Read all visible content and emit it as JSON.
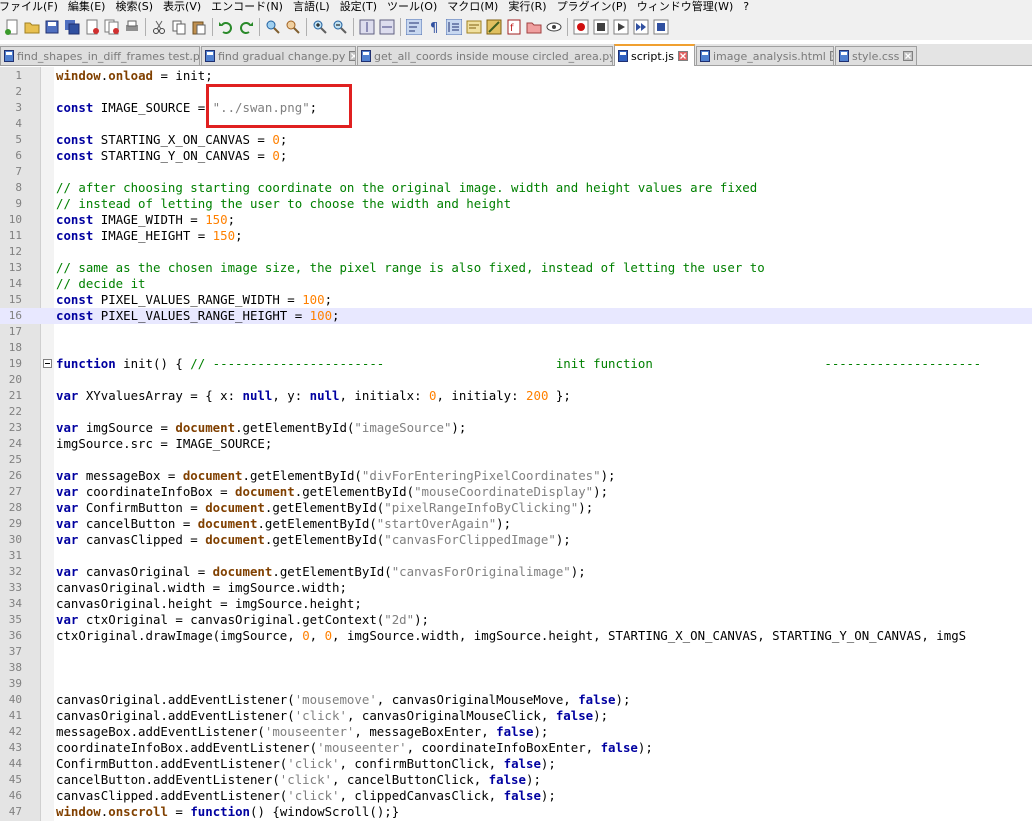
{
  "menu": [
    "ファイル(F)",
    "編集(E)",
    "検索(S)",
    "表示(V)",
    "エンコード(N)",
    "言語(L)",
    "設定(T)",
    "ツール(O)",
    "マクロ(M)",
    "実行(R)",
    "プラグイン(P)",
    "ウィンドウ管理(W)",
    "?"
  ],
  "toolbar": [
    "new-file-icon",
    "open-file-icon",
    "save-icon",
    "save-all-icon",
    "close-icon",
    "close-all-icon",
    "print-icon",
    "sep",
    "cut-icon",
    "copy-icon",
    "paste-icon",
    "sep",
    "undo-icon",
    "redo-icon",
    "sep",
    "find-icon",
    "replace-icon",
    "sep",
    "zoom-in-icon",
    "zoom-out-icon",
    "sep",
    "sync-v-icon",
    "sync-h-icon",
    "sep",
    "word-wrap-icon",
    "show-all-chars-icon",
    "indent-guide-icon",
    "udl-icon",
    "doc-map-icon",
    "function-list-icon",
    "folder-workspace-icon",
    "monitor-icon",
    "sep",
    "record-macro-icon",
    "stop-macro-icon",
    "play-macro-icon",
    "run-macro-multiple-icon",
    "save-macro-icon"
  ],
  "tabs": [
    {
      "label": "find_shapes_in_diff_frames test.py",
      "active": false,
      "file": "py"
    },
    {
      "label": "find gradual change.py",
      "active": false,
      "file": "py"
    },
    {
      "label": "get_all_coords inside mouse circled_area.py",
      "active": false,
      "file": "py"
    },
    {
      "label": "script.js",
      "active": true,
      "file": "js"
    },
    {
      "label": "image_analysis.html",
      "active": false,
      "file": "html"
    },
    {
      "label": "style.css",
      "active": false,
      "file": "css"
    }
  ],
  "editor": {
    "current_line": 16,
    "fold_line": 19,
    "highlight_text": "\"../swan.png\";",
    "lines": [
      {
        "n": "1",
        "t": [
          [
            "obj",
            "window"
          ],
          [
            "",
            "."
          ],
          [
            "obj",
            "onload"
          ],
          [
            "",
            " = init;"
          ]
        ]
      },
      {
        "n": "2",
        "t": []
      },
      {
        "n": "3",
        "t": [
          [
            "kw",
            "const"
          ],
          [
            "",
            " IMAGE_SOURCE = "
          ],
          [
            "str",
            "\"../swan.png\""
          ],
          [
            "",
            ";"
          ]
        ]
      },
      {
        "n": "4",
        "t": []
      },
      {
        "n": "5",
        "t": [
          [
            "kw",
            "const"
          ],
          [
            "",
            " STARTING_X_ON_CANVAS = "
          ],
          [
            "num",
            "0"
          ],
          [
            "",
            ";"
          ]
        ]
      },
      {
        "n": "6",
        "t": [
          [
            "kw",
            "const"
          ],
          [
            "",
            " STARTING_Y_ON_CANVAS = "
          ],
          [
            "num",
            "0"
          ],
          [
            "",
            ";"
          ]
        ]
      },
      {
        "n": "7",
        "t": []
      },
      {
        "n": "8",
        "t": [
          [
            "cmt",
            "// after choosing starting coordinate on the original image. width and height values are fixed"
          ]
        ]
      },
      {
        "n": "9",
        "t": [
          [
            "cmt",
            "// instead of letting the user to choose the width and height"
          ]
        ]
      },
      {
        "n": "10",
        "t": [
          [
            "kw",
            "const"
          ],
          [
            "",
            " IMAGE_WIDTH = "
          ],
          [
            "num",
            "150"
          ],
          [
            "",
            ";"
          ]
        ]
      },
      {
        "n": "11",
        "t": [
          [
            "kw",
            "const"
          ],
          [
            "",
            " IMAGE_HEIGHT = "
          ],
          [
            "num",
            "150"
          ],
          [
            "",
            ";"
          ]
        ]
      },
      {
        "n": "12",
        "t": []
      },
      {
        "n": "13",
        "t": [
          [
            "cmt",
            "// same as the chosen image size, the pixel range is also fixed, instead of letting the user to"
          ]
        ]
      },
      {
        "n": "14",
        "t": [
          [
            "cmt",
            "// decide it"
          ]
        ]
      },
      {
        "n": "15",
        "t": [
          [
            "kw",
            "const"
          ],
          [
            "",
            " PIXEL_VALUES_RANGE_WIDTH = "
          ],
          [
            "num",
            "100"
          ],
          [
            "",
            ";"
          ]
        ]
      },
      {
        "n": "16",
        "t": [
          [
            "kw",
            "const"
          ],
          [
            "",
            " PIXEL_VALUES_RANGE_HEIGHT = "
          ],
          [
            "num",
            "100"
          ],
          [
            "",
            ";"
          ]
        ]
      },
      {
        "n": "17",
        "t": []
      },
      {
        "n": "18",
        "t": []
      },
      {
        "n": "19",
        "t": [
          [
            "kw",
            "function"
          ],
          [
            "",
            " init() { "
          ],
          [
            "cmt",
            "// -----------------------                       init function                       ---------------------"
          ]
        ]
      },
      {
        "n": "20",
        "t": []
      },
      {
        "n": "21",
        "t": [
          [
            "kw",
            "var"
          ],
          [
            "",
            " XYvaluesArray = { x: "
          ],
          [
            "kw",
            "null"
          ],
          [
            "",
            ", y: "
          ],
          [
            "kw",
            "null"
          ],
          [
            "",
            ", initialx: "
          ],
          [
            "num",
            "0"
          ],
          [
            "",
            ", initialy: "
          ],
          [
            "num",
            "200"
          ],
          [
            "",
            " };"
          ]
        ]
      },
      {
        "n": "22",
        "t": []
      },
      {
        "n": "23",
        "t": [
          [
            "kw",
            "var"
          ],
          [
            "",
            " imgSource = "
          ],
          [
            "obj",
            "document"
          ],
          [
            "",
            ".getElementById("
          ],
          [
            "str",
            "\"imageSource\""
          ],
          [
            "",
            ");"
          ]
        ]
      },
      {
        "n": "24",
        "t": [
          [
            "",
            "imgSource.src = IMAGE_SOURCE;"
          ]
        ]
      },
      {
        "n": "25",
        "t": []
      },
      {
        "n": "26",
        "t": [
          [
            "kw",
            "var"
          ],
          [
            "",
            " messageBox = "
          ],
          [
            "obj",
            "document"
          ],
          [
            "",
            ".getElementById("
          ],
          [
            "str",
            "\"divForEnteringPixelCoordinates\""
          ],
          [
            "",
            ");"
          ]
        ]
      },
      {
        "n": "27",
        "t": [
          [
            "kw",
            "var"
          ],
          [
            "",
            " coordinateInfoBox = "
          ],
          [
            "obj",
            "document"
          ],
          [
            "",
            ".getElementById("
          ],
          [
            "str",
            "\"mouseCoordinateDisplay\""
          ],
          [
            "",
            ");"
          ]
        ]
      },
      {
        "n": "28",
        "t": [
          [
            "kw",
            "var"
          ],
          [
            "",
            " ConfirmButton = "
          ],
          [
            "obj",
            "document"
          ],
          [
            "",
            ".getElementById("
          ],
          [
            "str",
            "\"pixelRangeInfoByClicking\""
          ],
          [
            "",
            ");"
          ]
        ]
      },
      {
        "n": "29",
        "t": [
          [
            "kw",
            "var"
          ],
          [
            "",
            " cancelButton = "
          ],
          [
            "obj",
            "document"
          ],
          [
            "",
            ".getElementById("
          ],
          [
            "str",
            "\"startOverAgain\""
          ],
          [
            "",
            ");"
          ]
        ]
      },
      {
        "n": "30",
        "t": [
          [
            "kw",
            "var"
          ],
          [
            "",
            " canvasClipped = "
          ],
          [
            "obj",
            "document"
          ],
          [
            "",
            ".getElementById("
          ],
          [
            "str",
            "\"canvasForClippedImage\""
          ],
          [
            "",
            ");"
          ]
        ]
      },
      {
        "n": "31",
        "t": []
      },
      {
        "n": "32",
        "t": [
          [
            "kw",
            "var"
          ],
          [
            "",
            " canvasOriginal = "
          ],
          [
            "obj",
            "document"
          ],
          [
            "",
            ".getElementById("
          ],
          [
            "str",
            "\"canvasForOriginalimage\""
          ],
          [
            "",
            ");"
          ]
        ]
      },
      {
        "n": "33",
        "t": [
          [
            "",
            "canvasOriginal.width = imgSource.width;"
          ]
        ]
      },
      {
        "n": "34",
        "t": [
          [
            "",
            "canvasOriginal.height = imgSource.height;"
          ]
        ]
      },
      {
        "n": "35",
        "t": [
          [
            "kw",
            "var"
          ],
          [
            "",
            " ctxOriginal = canvasOriginal.getContext("
          ],
          [
            "str",
            "\"2d\""
          ],
          [
            "",
            ");"
          ]
        ]
      },
      {
        "n": "36",
        "t": [
          [
            "",
            "ctxOriginal.drawImage(imgSource, "
          ],
          [
            "num",
            "0"
          ],
          [
            "",
            ", "
          ],
          [
            "num",
            "0"
          ],
          [
            "",
            ", imgSource.width, imgSource.height, STARTING_X_ON_CANVAS, STARTING_Y_ON_CANVAS, imgS"
          ]
        ]
      },
      {
        "n": "37",
        "t": []
      },
      {
        "n": "38",
        "t": []
      },
      {
        "n": "39",
        "t": []
      },
      {
        "n": "40",
        "t": [
          [
            "",
            "canvasOriginal.addEventListener("
          ],
          [
            "str",
            "'mousemove'"
          ],
          [
            "",
            ", canvasOriginalMouseMove, "
          ],
          [
            "kw",
            "false"
          ],
          [
            "",
            ");"
          ]
        ]
      },
      {
        "n": "41",
        "t": [
          [
            "",
            "canvasOriginal.addEventListener("
          ],
          [
            "str",
            "'click'"
          ],
          [
            "",
            ", canvasOriginalMouseClick, "
          ],
          [
            "kw",
            "false"
          ],
          [
            "",
            ");"
          ]
        ]
      },
      {
        "n": "42",
        "t": [
          [
            "",
            "messageBox.addEventListener("
          ],
          [
            "str",
            "'mouseenter'"
          ],
          [
            "",
            ", messageBoxEnter, "
          ],
          [
            "kw",
            "false"
          ],
          [
            "",
            ");"
          ]
        ]
      },
      {
        "n": "43",
        "t": [
          [
            "",
            "coordinateInfoBox.addEventListener("
          ],
          [
            "str",
            "'mouseenter'"
          ],
          [
            "",
            ", coordinateInfoBoxEnter, "
          ],
          [
            "kw",
            "false"
          ],
          [
            "",
            ");"
          ]
        ]
      },
      {
        "n": "44",
        "t": [
          [
            "",
            "ConfirmButton.addEventListener("
          ],
          [
            "str",
            "'click'"
          ],
          [
            "",
            ", confirmButtonClick, "
          ],
          [
            "kw",
            "false"
          ],
          [
            "",
            ");"
          ]
        ]
      },
      {
        "n": "45",
        "t": [
          [
            "",
            "cancelButton.addEventListener("
          ],
          [
            "str",
            "'click'"
          ],
          [
            "",
            ", cancelButtonClick, "
          ],
          [
            "kw",
            "false"
          ],
          [
            "",
            ");"
          ]
        ]
      },
      {
        "n": "46",
        "t": [
          [
            "",
            "canvasClipped.addEventListener("
          ],
          [
            "str",
            "'click'"
          ],
          [
            "",
            ", clippedCanvasClick, "
          ],
          [
            "kw",
            "false"
          ],
          [
            "",
            ");"
          ]
        ]
      },
      {
        "n": "47",
        "t": [
          [
            "obj",
            "window"
          ],
          [
            "",
            "."
          ],
          [
            "obj",
            "onscroll"
          ],
          [
            "",
            " = "
          ],
          [
            "kw",
            "function"
          ],
          [
            "",
            "() {windowScroll();}"
          ]
        ]
      }
    ]
  },
  "colors": {
    "keyword": "#0000a0",
    "object": "#804000",
    "string": "#808080",
    "number": "#ff8000",
    "comment": "#008000",
    "highlight_box": "#e02020",
    "active_tab_accent": "#f0a030"
  }
}
